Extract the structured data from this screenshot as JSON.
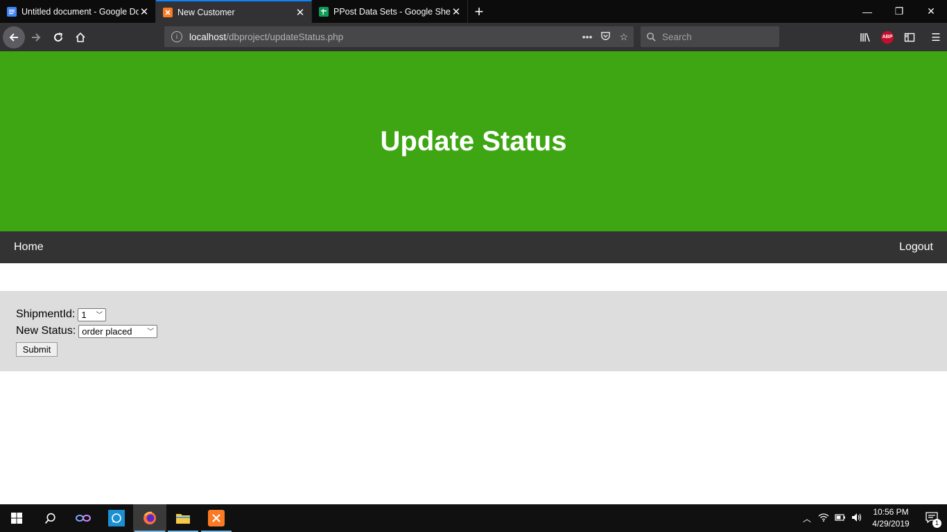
{
  "browser": {
    "tabs": [
      {
        "title": "Untitled document - Google Do",
        "icon": "google-docs-icon",
        "color": "#4285f4",
        "active": false
      },
      {
        "title": "New Customer",
        "icon": "xampp-icon",
        "color": "#fb7a24",
        "active": true
      },
      {
        "title": "PPost Data Sets - Google Sheet",
        "icon": "google-sheets-icon",
        "color": "#0f9d58",
        "active": false
      }
    ],
    "url_host": "localhost",
    "url_path": "/dbproject/updateStatus.php",
    "search_placeholder": "Search"
  },
  "page": {
    "heading": "Update Status",
    "nav": {
      "home": "Home",
      "logout": "Logout"
    },
    "form": {
      "shipment_label": "ShipmentId:",
      "shipment_value": "1",
      "status_label": "New Status:",
      "status_value": "order placed",
      "submit_label": "Submit"
    },
    "colors": {
      "hero": "#3ea613",
      "nav": "#333333",
      "form_bg": "#dddddd"
    }
  },
  "taskbar": {
    "time": "10:56 PM",
    "date": "4/29/2019",
    "notification_count": "1"
  }
}
